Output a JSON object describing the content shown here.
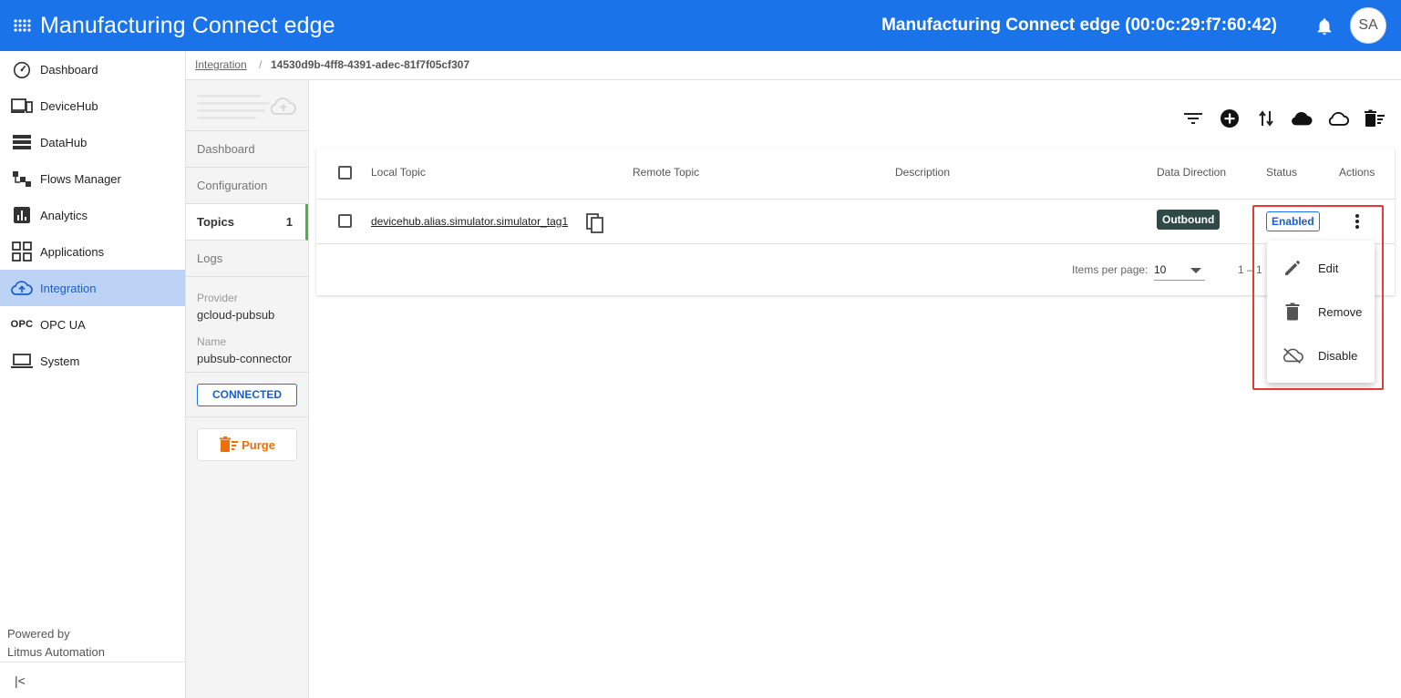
{
  "header": {
    "app_title": "Manufacturing Connect edge",
    "device_title": "Manufacturing Connect edge (00:0c:29:f7:60:42)",
    "avatar_initials": "SA",
    "brand_color": "#1a73e8"
  },
  "sidebar": {
    "items": [
      {
        "label": "Dashboard",
        "icon": "speedometer-icon",
        "active": false
      },
      {
        "label": "DeviceHub",
        "icon": "devices-icon",
        "active": false
      },
      {
        "label": "DataHub",
        "icon": "storage-icon",
        "active": false
      },
      {
        "label": "Flows Manager",
        "icon": "flow-icon",
        "active": false
      },
      {
        "label": "Analytics",
        "icon": "analytics-icon",
        "active": false
      },
      {
        "label": "Applications",
        "icon": "apps-grid-icon",
        "active": false
      },
      {
        "label": "Integration",
        "icon": "cloud-upload-icon",
        "active": true
      },
      {
        "label": "OPC UA",
        "icon": "opc-icon",
        "icon_text": "OPC",
        "active": false
      },
      {
        "label": "System",
        "icon": "laptop-icon",
        "active": false
      }
    ],
    "powered_by_line1": "Powered by",
    "powered_by_line2": "Litmus Automation",
    "collapse_icon": "|<"
  },
  "breadcrumb": {
    "parent": "Integration",
    "separator": "/",
    "current": "14530d9b-4ff8-4391-adec-81f7f05cf307"
  },
  "subnav": {
    "items": [
      {
        "label": "Dashboard"
      },
      {
        "label": "Configuration"
      },
      {
        "label": "Topics",
        "count": "1",
        "active": true
      },
      {
        "label": "Logs"
      }
    ],
    "provider_label": "Provider",
    "provider_value": "gcloud-pubsub",
    "name_label": "Name",
    "name_value": "pubsub-connector",
    "connection_status": "CONNECTED",
    "purge_label": "Purge"
  },
  "toolbar": {
    "icons": [
      "filter-icon",
      "add-circle-icon",
      "swap-vert-icon",
      "cloud-icon",
      "cloud-outline-icon",
      "delete-sweep-icon"
    ]
  },
  "table": {
    "columns": [
      "Local Topic",
      "Remote Topic",
      "Description",
      "Data Direction",
      "Status",
      "Actions"
    ],
    "rows": [
      {
        "local_topic": "devicehub.alias.simulator.simulator_tag1",
        "remote_topic": "",
        "description": "",
        "data_direction": "Outbound",
        "status": "Enabled"
      }
    ],
    "items_per_page_label": "Items per page:",
    "items_per_page_value": "10",
    "range_text": "1 – 1"
  },
  "context_menu": {
    "items": [
      {
        "label": "Edit",
        "icon": "pencil-icon"
      },
      {
        "label": "Remove",
        "icon": "trash-icon"
      },
      {
        "label": "Disable",
        "icon": "cloud-off-icon"
      }
    ]
  }
}
